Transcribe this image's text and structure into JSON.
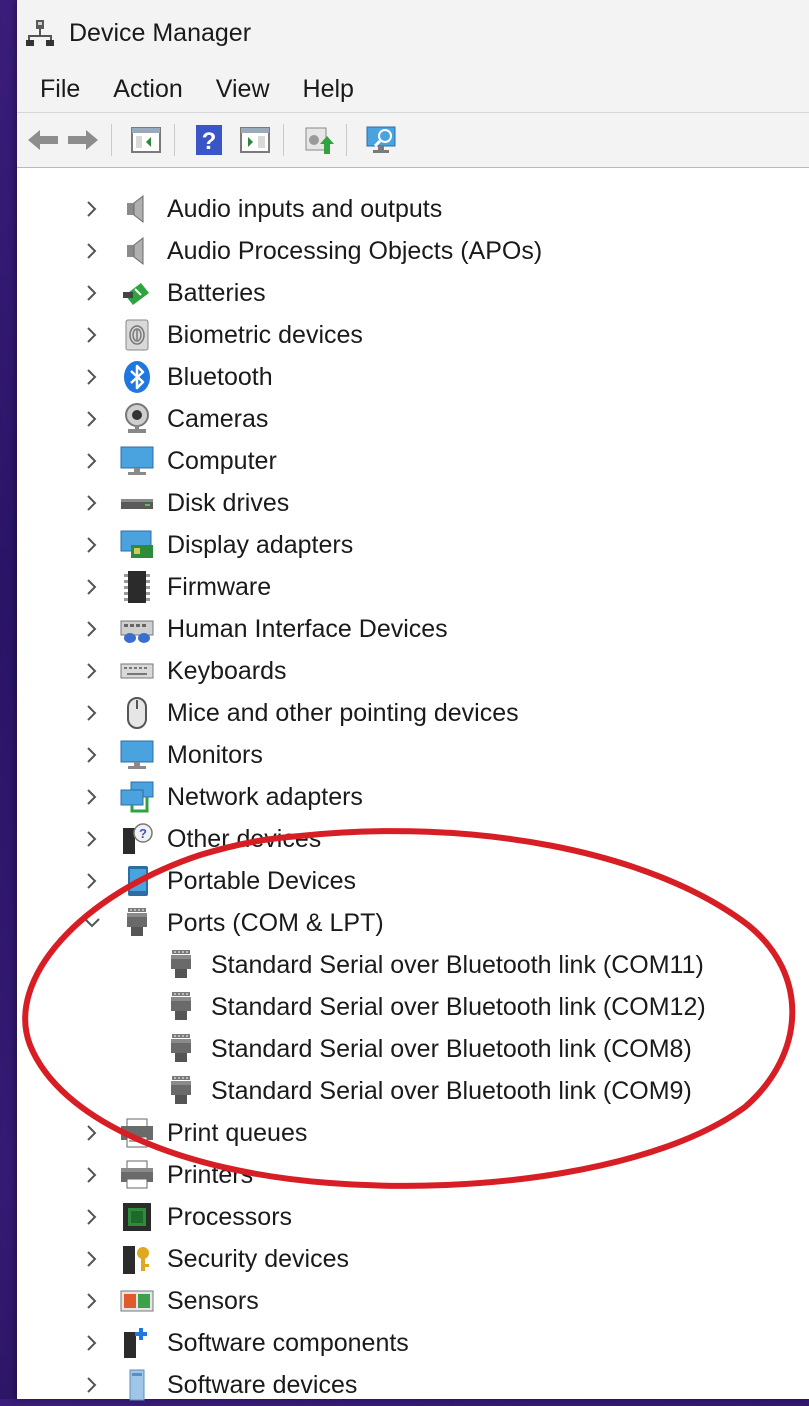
{
  "window": {
    "title": "Device Manager"
  },
  "menu": [
    "File",
    "Action",
    "View",
    "Help"
  ],
  "toolbar": [
    "back-icon",
    "forward-icon",
    "show-hide-console-tree-icon",
    "help-icon",
    "properties-pane-icon",
    "update-driver-icon",
    "scan-hardware-changes-icon"
  ],
  "tree": {
    "categories": [
      {
        "label": "Audio inputs and outputs",
        "icon": "speaker-icon",
        "expanded": false
      },
      {
        "label": "Audio Processing Objects (APOs)",
        "icon": "speaker-icon",
        "expanded": false
      },
      {
        "label": "Batteries",
        "icon": "battery-icon",
        "expanded": false
      },
      {
        "label": "Biometric devices",
        "icon": "fingerprint-icon",
        "expanded": false
      },
      {
        "label": "Bluetooth",
        "icon": "bluetooth-icon",
        "expanded": false
      },
      {
        "label": "Cameras",
        "icon": "webcam-icon",
        "expanded": false
      },
      {
        "label": "Computer",
        "icon": "computer-icon",
        "expanded": false
      },
      {
        "label": "Disk drives",
        "icon": "disk-drive-icon",
        "expanded": false
      },
      {
        "label": "Display adapters",
        "icon": "display-adapter-icon",
        "expanded": false
      },
      {
        "label": "Firmware",
        "icon": "firmware-chip-icon",
        "expanded": false
      },
      {
        "label": "Human Interface Devices",
        "icon": "hid-icon",
        "expanded": false
      },
      {
        "label": "Keyboards",
        "icon": "keyboard-icon",
        "expanded": false
      },
      {
        "label": "Mice and other pointing devices",
        "icon": "mouse-icon",
        "expanded": false
      },
      {
        "label": "Monitors",
        "icon": "monitor-icon",
        "expanded": false
      },
      {
        "label": "Network adapters",
        "icon": "network-adapter-icon",
        "expanded": false
      },
      {
        "label": "Other devices",
        "icon": "unknown-device-icon",
        "expanded": false
      },
      {
        "label": "Portable Devices",
        "icon": "portable-device-icon",
        "expanded": false
      },
      {
        "label": "Ports (COM & LPT)",
        "icon": "port-connector-icon",
        "expanded": true,
        "children": [
          "Standard Serial over Bluetooth link (COM11)",
          "Standard Serial over Bluetooth link (COM12)",
          "Standard Serial over Bluetooth link (COM8)",
          "Standard Serial over Bluetooth link (COM9)"
        ]
      },
      {
        "label": "Print queues",
        "icon": "print-queue-icon",
        "expanded": false
      },
      {
        "label": "Printers",
        "icon": "printer-icon",
        "expanded": false
      },
      {
        "label": "Processors",
        "icon": "processor-icon",
        "expanded": false
      },
      {
        "label": "Security devices",
        "icon": "security-device-icon",
        "expanded": false
      },
      {
        "label": "Sensors",
        "icon": "sensor-icon",
        "expanded": false
      },
      {
        "label": "Software components",
        "icon": "software-component-icon",
        "expanded": false
      },
      {
        "label": "Software devices",
        "icon": "software-device-icon",
        "expanded": false
      }
    ]
  },
  "colors": {
    "annotation": "#d81e25",
    "accent": "#0078d4",
    "background": "#2e176c"
  }
}
